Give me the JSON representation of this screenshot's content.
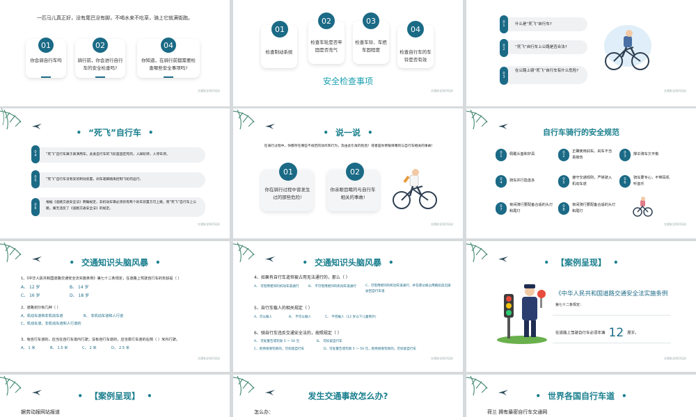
{
  "slides": {
    "s1": {
      "text": "一匹马儿真正好，没有尾巴没有脚，不喝水来不吃草，骑上它就满街跑。",
      "cards": [
        {
          "num": "01",
          "text": "你会骑自行车吗"
        },
        {
          "num": "02",
          "text": "骑行前，你会进行自行车的安全检查吗?"
        },
        {
          "num": "04",
          "text": "你知道，在骑行前都需要检查哪些安全事项吗?"
        }
      ],
      "footer": "交通安全知识培训"
    },
    "s2": {
      "cards": [
        {
          "num": "01",
          "text": "检查制动系统"
        },
        {
          "num": "02",
          "text": "检查车轮是否牢固是否充气"
        },
        {
          "num": "03",
          "text": "检查车铃、车把车固程度"
        },
        {
          "num": "04",
          "text": "检查自行车的车铃是否有效"
        }
      ],
      "subtitle": "安全检查事项",
      "footer": "交通安全知识培训"
    },
    "s3": {
      "items": [
        {
          "num": "01",
          "text": "什么是“死飞”自行车?"
        },
        {
          "num": "02",
          "text": "“死飞”自行车上公路是否合法?"
        },
        {
          "num": "03",
          "text": "在公路上骑“死飞”自行车有什么危险?"
        }
      ],
      "footer": "交通安全知识培训"
    },
    "s4": {
      "title": "“死飞”自行车",
      "items": [
        {
          "num": "04",
          "text": "“死飞”自行车属于表演用车。此类自行车的飞轮是固定死的，人踩轮转，人停车停。"
        },
        {
          "num": "05",
          "text": "“死飞”自行车没有安装制动装置，刹车靠脚踏来控制飞轮的运行。"
        },
        {
          "num": "06",
          "text": "根据《道路交通安全法》明确规定，非机动车辆必须装有两个刹车装置方可上路，而“死飞”自行车上公路，属无违反了《道路交通安全法》的规定。"
        }
      ],
      "footer": "交通安全知识培训"
    },
    "s5": {
      "title": "说一说",
      "text": "在骑行过程中，你都存在哪些不规范的动作和行为，及由此引发的危险！或者是你亲眼目睹的与自行车相关的事故！",
      "cards": [
        {
          "num": "01",
          "text": "你在骑行过程中曾发生过的那些危险!"
        },
        {
          "num": "02",
          "text": "你亲眼目睹的与自行车相关的事故!"
        }
      ],
      "footer": "交通安全知识培训"
    },
    "s6": {
      "title": "自行车骑行的安全规范",
      "items": [
        {
          "num": "01",
          "text": "佩戴头盔和护具"
        },
        {
          "num": "02",
          "text": "正确使用刹车。刹车不当易摔伤"
        },
        {
          "num": "03",
          "text": "撑伞骑车欠平衡"
        },
        {
          "num": "04",
          "text": "骑车并行隐患多"
        },
        {
          "num": "05",
          "text": "遵守交通规则，严禁驶入机动车道"
        },
        {
          "num": "06",
          "text": "骑车要专心，不带耳机听音乐"
        },
        {
          "num": "07",
          "text": "夜间骑行要配备合适的头灯和尾灯"
        },
        {
          "num": "08",
          "text": "夜间骑行要配备合适的头灯和尾灯"
        }
      ],
      "footer": "交通安全知识培训"
    },
    "s7": {
      "title": "交通知识头脑风暴",
      "q1": "1、《中华人民共和国道路交通安全法实施条例》第七十二条规定，在道路上驾驶自行车的年龄是（ ）",
      "q1a": [
        "A、 12 岁",
        "B、 14 岁",
        "C、 16 岁",
        "D、 18 岁"
      ],
      "q2": "2、道路划分有几种（ ）",
      "q2a": [
        "A、机动车道和非机动车道",
        "B、 非机动车道和人行道",
        "C、机动车道、非机动车道和人行道的"
      ],
      "q3": "3、有自行车道的，应当在自行车道内行驶；没有自行车道的，应当靠行车道的右侧（ ）米内行驶。",
      "q3a": [
        "A、 1 米",
        "B、 1.5 米",
        "C、 2 米",
        "D、 2.5 米"
      ],
      "footer": "交通安全知识培训"
    },
    "s8": {
      "title": "交通知识头脑风暴",
      "q4": "4、如果有自行车道但被占用无法通行的，那么（ ）",
      "q4a": [
        "A、 可借用相邻的机动车道通行",
        "B、 不可借用相邻的机动车道通行",
        "C、可借用相邻的机动车道通行，并在使过被占用路段后迅速驶回自行车道"
      ],
      "q5": "5、自行车载人的相关规定（ ）",
      "q5a": [
        "A、可以载人",
        "B、 不可以载人",
        "C、 不得载人（12 岁以下儿童例外）"
      ],
      "q6": "6、骑自行车违反交通安全法的，按照规定（ ）",
      "q6a": [
        "A、 可处警告或罚款 5 ～ 50 元",
        "B、 可扣留自行车",
        "C、拒绝接受罚款的，可扣留自行车",
        "D、可处警告或罚款 5 ～ 50 元，拒绝接受罚款的，可扣留自行车"
      ],
      "footer": "交通安全知识培训"
    },
    "s9": {
      "title": "【案例呈现】",
      "law": "《中华人民共和国道路交通安全法实施条例",
      "article": "第七十二条规定：",
      "age_text_pre": "在道路上驾驶自行车必须年满",
      "age": "12",
      "age_text_post": "周岁。",
      "footer": "交通安全知识培训"
    },
    "s10": {
      "title": "【案例呈现】",
      "text": "据劳动报网站报道"
    },
    "s11": {
      "title": "发生交通事故怎么办?",
      "text": "怎么办："
    },
    "s12": {
      "title": "世界各国自行车道",
      "text": "荷兰 拥有最密自行车交通网"
    }
  },
  "colors": {
    "accent": "#1b6a86",
    "title": "#1a7f8e"
  }
}
